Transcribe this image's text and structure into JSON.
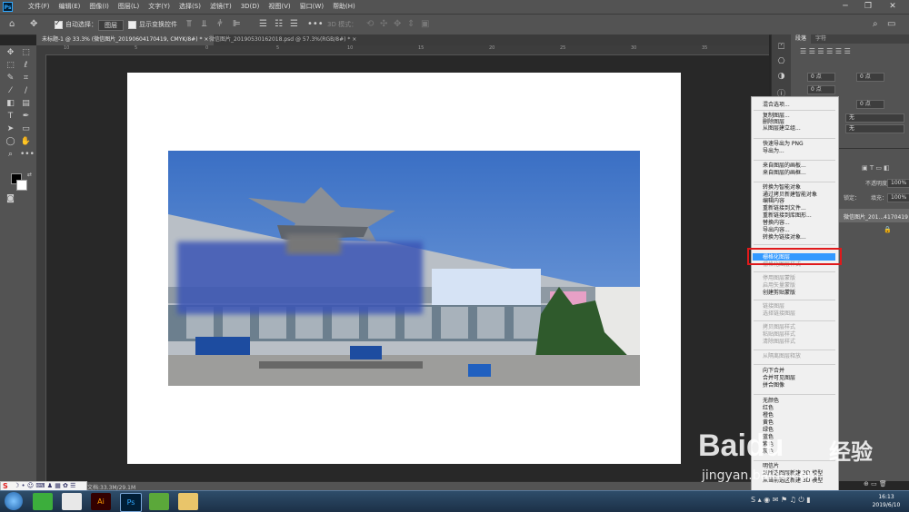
{
  "menubar": {
    "items": [
      "文件(F)",
      "编辑(E)",
      "图像(I)",
      "图层(L)",
      "文字(Y)",
      "选择(S)",
      "滤镜(T)",
      "3D(D)",
      "视图(V)",
      "窗口(W)",
      "帮助(H)"
    ],
    "logo": "Ps"
  },
  "optionsbar": {
    "auto_select_label": "自动选择：",
    "auto_select_value": "图层",
    "show_transform_label": "显示变换控件",
    "mode_label": "3D 模式："
  },
  "tabs": [
    {
      "label": "未标题-1 @ 33.3% (微信图片_20190604170419, CMYK/8#) *",
      "close": "×"
    },
    {
      "label": "微信图片_20190530162018.psd @ 57.3%(RGB/8#) *",
      "close": "×"
    }
  ],
  "right_panel": {
    "tabs": [
      "段落",
      "字符"
    ],
    "fields": [
      "0 点",
      "0 点",
      "0 点",
      "0 点"
    ],
    "dropdowns": [
      "无",
      "无"
    ],
    "layers": {
      "opacity_label": "不透明度：",
      "opacity_value": "100%",
      "fill_label": "填充：",
      "fill_value": "100%",
      "lock_label": "锁定：",
      "layer_name": "微信图片_201...4170419"
    }
  },
  "context_menu": {
    "items": [
      {
        "label": "混合选项...",
        "enabled": true
      },
      {
        "label": "复制图层...",
        "enabled": true
      },
      {
        "label": "删除图层",
        "enabled": true
      },
      {
        "label": "从图层建立组...",
        "enabled": true
      },
      {
        "label": "快速导出为 PNG",
        "enabled": true
      },
      {
        "label": "导出为...",
        "enabled": true
      },
      {
        "label": "来自图层的画板...",
        "enabled": true
      },
      {
        "label": "来自图层的画框...",
        "enabled": true
      },
      {
        "label": "转换为智能对象",
        "enabled": true
      },
      {
        "label": "通过拷贝新建智能对象",
        "enabled": true
      },
      {
        "label": "编辑内容",
        "enabled": true
      },
      {
        "label": "重新链接到文件...",
        "enabled": true
      },
      {
        "label": "重新链接到库图形...",
        "enabled": true
      },
      {
        "label": "替换内容...",
        "enabled": true
      },
      {
        "label": "导出内容...",
        "enabled": true
      },
      {
        "label": "转换为链接对象...",
        "enabled": true
      },
      {
        "label": "栅格化图层",
        "enabled": true,
        "highlighted": true
      },
      {
        "label": "栅格化图层样式",
        "enabled": false
      },
      {
        "label": "停用图层蒙版",
        "enabled": false
      },
      {
        "label": "启用矢量蒙版",
        "enabled": false
      },
      {
        "label": "创建剪贴蒙版",
        "enabled": true
      },
      {
        "label": "链接图层",
        "enabled": false
      },
      {
        "label": "选择链接图层",
        "enabled": false
      },
      {
        "label": "拷贝图层样式",
        "enabled": false
      },
      {
        "label": "粘贴图层样式",
        "enabled": false
      },
      {
        "label": "清除图层样式",
        "enabled": false
      },
      {
        "label": "从隔离图层释放",
        "enabled": false
      },
      {
        "label": "向下合并",
        "enabled": true
      },
      {
        "label": "合并可见图层",
        "enabled": true
      },
      {
        "label": "拼合图像",
        "enabled": true
      },
      {
        "label": "无颜色",
        "enabled": true
      },
      {
        "label": "红色",
        "enabled": true
      },
      {
        "label": "橙色",
        "enabled": true
      },
      {
        "label": "黄色",
        "enabled": true
      },
      {
        "label": "绿色",
        "enabled": true
      },
      {
        "label": "蓝色",
        "enabled": true
      },
      {
        "label": "紫色",
        "enabled": true
      },
      {
        "label": "灰色",
        "enabled": true
      },
      {
        "label": "明信片",
        "enabled": true
      },
      {
        "label": "从所选图层新建 3D 模型",
        "enabled": true
      },
      {
        "label": "从当前选区新建 3D 模型",
        "enabled": true
      }
    ]
  },
  "statusbar": {
    "doc_info": "文档:33.3M/29.1M"
  },
  "taskbar": {
    "time": "16:13",
    "date": "2019/6/10"
  },
  "watermark": {
    "brand": "Baidu",
    "brand_cn": "经验",
    "url": "jingyan.baidu.com"
  },
  "colors": {
    "highlight": "#3399ff",
    "annotation_red": "#e0191b",
    "ps_blue": "#31a8ff"
  }
}
